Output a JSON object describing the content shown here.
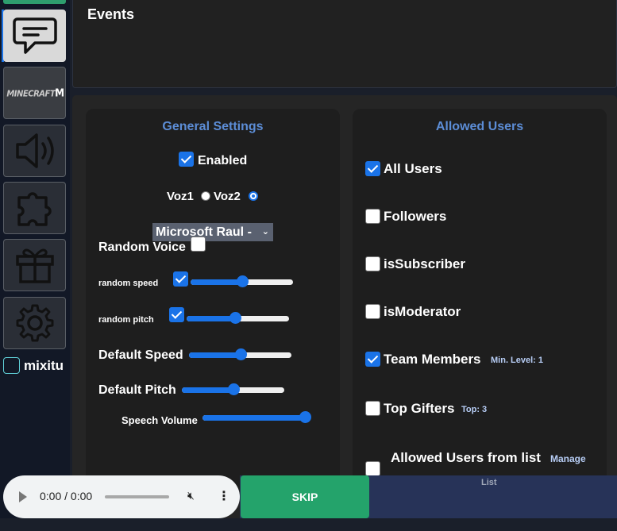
{
  "events": {
    "title": "Events"
  },
  "sidebar": {
    "username": "mixitu",
    "minecraft_label": "MINECRAFT",
    "minecraft_suffix": "M",
    "icons": [
      "chat-icon",
      "minecraft-icon",
      "speaker-icon",
      "puzzle-icon",
      "gift-icon",
      "gear-icon"
    ]
  },
  "general": {
    "title": "General Settings",
    "enabled_label": "Enabled",
    "enabled": true,
    "voz1": "Voz1",
    "voz2": "Voz2",
    "voz_selected": "Voz2",
    "voice_select": "Microsoft Raul -",
    "random_voice_label": "Random Voice",
    "random_voice": false,
    "random_speed_label": "random speed",
    "random_speed": true,
    "random_speed_value": 0.5,
    "random_pitch_label": "random pitch",
    "random_pitch": true,
    "random_pitch_value": 0.47,
    "default_speed_label": "Default Speed",
    "default_speed_value": 0.5,
    "default_pitch_label": "Default Pitch",
    "default_pitch_value": 0.5,
    "speech_volume_label": "Speech Volume",
    "speech_volume_value": 1.0
  },
  "allowed": {
    "title": "Allowed Users",
    "items": [
      {
        "label": "All Users",
        "checked": true,
        "extra": ""
      },
      {
        "label": "Followers",
        "checked": false,
        "extra": ""
      },
      {
        "label": "isSubscriber",
        "checked": false,
        "extra": ""
      },
      {
        "label": "isModerator",
        "checked": false,
        "extra": ""
      },
      {
        "label": "Team Members",
        "checked": true,
        "extra": "Min. Level: 1"
      },
      {
        "label": "Top Gifters",
        "checked": false,
        "extra": "Top: 3"
      },
      {
        "label": "Allowed Users from list",
        "checked": false,
        "extra": "Manage"
      }
    ],
    "list_label": "List"
  },
  "player": {
    "time": "0:00 / 0:00",
    "progress": 0
  },
  "skip_label": "SKIP",
  "colors": {
    "accent": "#1a73e8",
    "title_blue": "#5c8dd6",
    "skip_green": "#24a36b",
    "panel": "#1e1e1e"
  }
}
